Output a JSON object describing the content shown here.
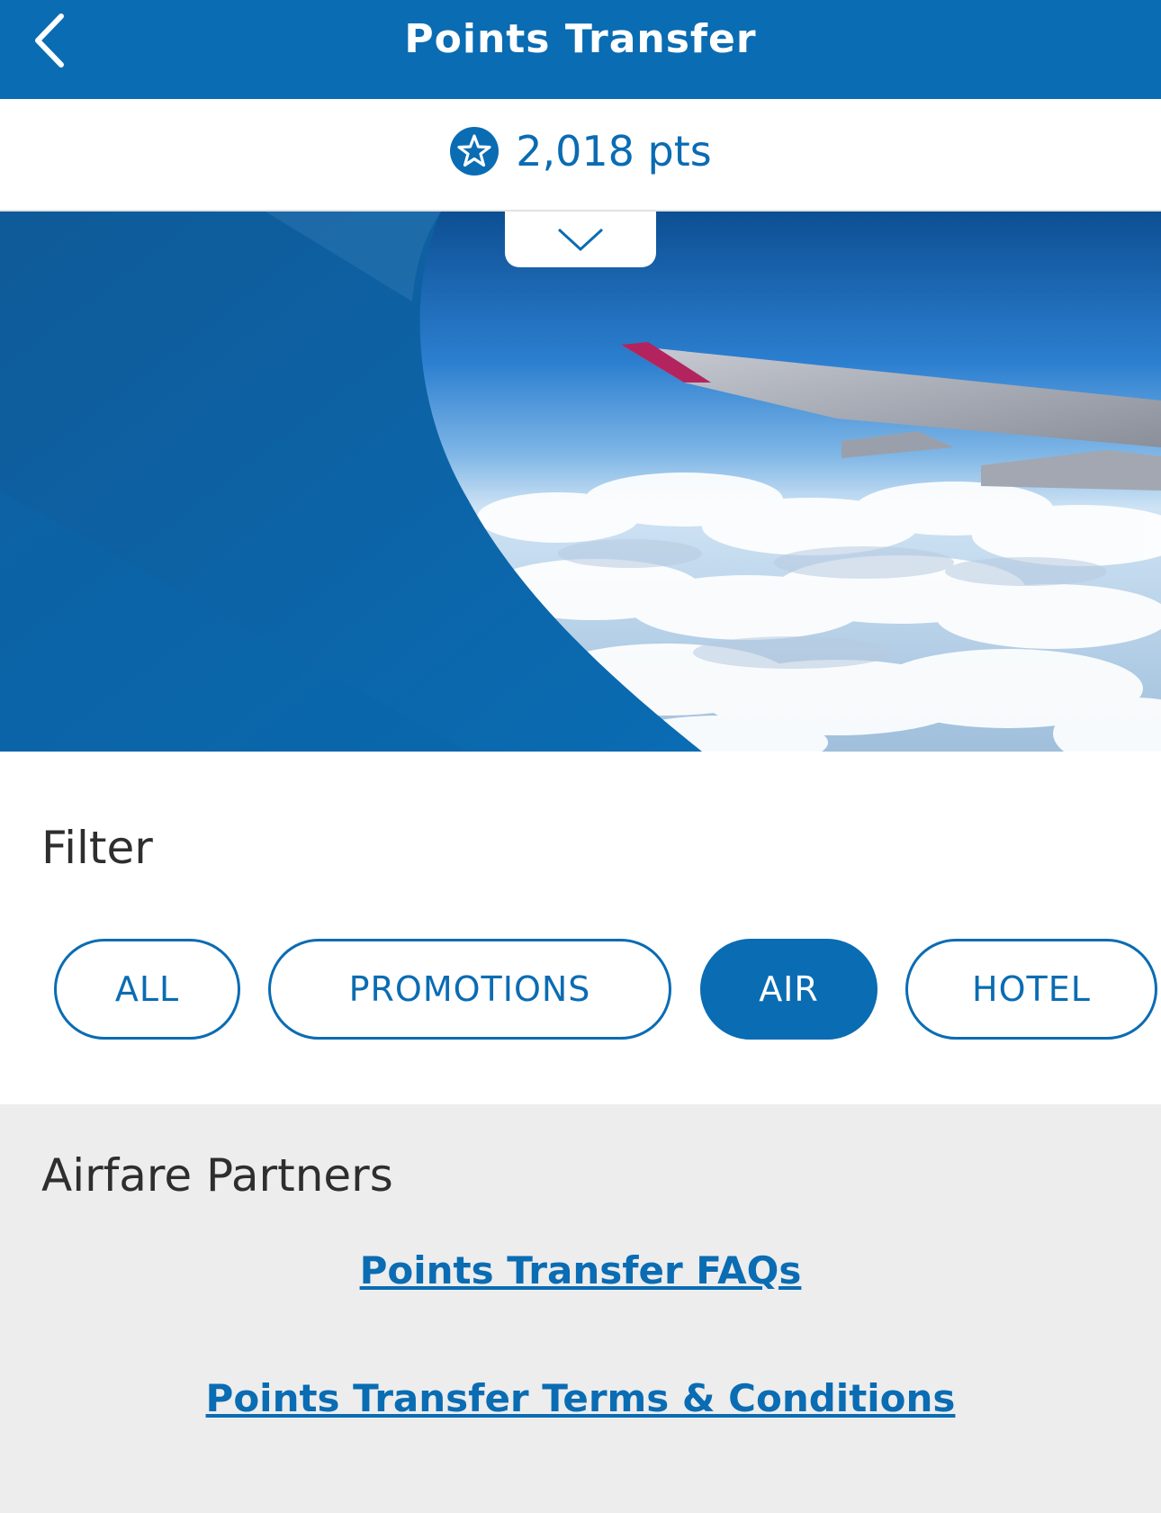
{
  "header": {
    "title": "Points Transfer",
    "back_icon": "chevron-left-icon"
  },
  "points": {
    "icon": "star-circle-icon",
    "value": "2,018 pts"
  },
  "hero": {
    "expand_icon": "chevron-down-icon"
  },
  "filter": {
    "title": "Filter",
    "options": [
      {
        "label": "ALL",
        "selected": false
      },
      {
        "label": "PROMOTIONS",
        "selected": false
      },
      {
        "label": "AIR",
        "selected": true
      },
      {
        "label": "HOTEL",
        "selected": false
      }
    ]
  },
  "partners": {
    "title": "Airfare Partners",
    "links": [
      {
        "label": "Points Transfer FAQs"
      },
      {
        "label": "Points Transfer Terms & Conditions"
      }
    ]
  },
  "colors": {
    "brand": "#0a6cb3",
    "background_gray": "#ededed",
    "text_dark": "#2e2e2e"
  }
}
